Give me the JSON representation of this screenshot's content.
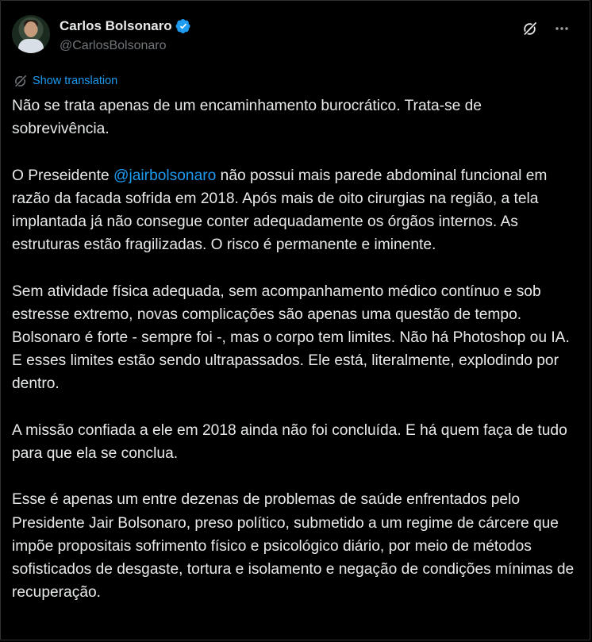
{
  "author": {
    "name": "Carlos Bolsonaro",
    "handle": "@CarlosBolsonaro",
    "verified_color": "#1d9bf0"
  },
  "actions": {
    "grok_icon": "grok-slash-icon",
    "more_icon": "more-horizontal-icon"
  },
  "translation": {
    "label": "Show translation",
    "icon": "translate-icon"
  },
  "post": {
    "p1": "Não se trata apenas de um encaminhamento burocrático. Trata-se de sobrevivência.",
    "p2_before": "O Preseidente ",
    "p2_mention": "@jairbolsonaro",
    "p2_after": " não possui mais parede abdominal funcional em razão da facada sofrida em 2018. Após mais de oito cirurgias na região, a tela implantada já não consegue conter adequadamente os órgãos internos. As estruturas estão fragilizadas. O risco é permanente e iminente.",
    "p3": "Sem atividade física adequada, sem acompanhamento médico contínuo e sob estresse extremo, novas complicações são apenas uma questão de tempo.",
    "p4": "Bolsonaro é forte - sempre foi -, mas o corpo tem limites. Não há Photoshop ou IA. E esses limites estão sendo ultrapassados. Ele está, literalmente, explodindo por dentro.",
    "p5": "A missão confiada a ele em 2018 ainda não foi concluída. E há quem faça de tudo para que ela se conclua.",
    "p6": "Esse é apenas um entre dezenas de problemas de saúde enfrentados pelo Presidente Jair Bolsonaro, preso político, submetido a um regime de cárcere que impõe propositais sofrimento físico e psicológico diário, por meio de métodos sofisticados de desgaste, tortura e isolamento e negação de condições mínimas de recuperação."
  },
  "colors": {
    "background": "#000000",
    "text": "#e7e9ea",
    "muted": "#71767b",
    "link": "#1d9bf0"
  }
}
